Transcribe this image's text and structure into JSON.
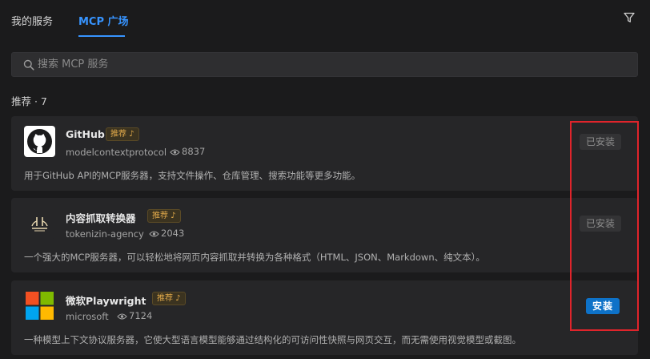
{
  "tabs": [
    {
      "label": "我的服务",
      "active": false
    },
    {
      "label": "MCP 广场",
      "active": true
    }
  ],
  "search": {
    "placeholder": "搜索 MCP 服务"
  },
  "section": {
    "label": "推荐 · 7"
  },
  "cards": [
    {
      "name": "GitHub",
      "badge": "推荐",
      "author": "modelcontextprotocol",
      "views": "8837",
      "description": "用于GitHub API的MCP服务器，支持文件操作、仓库管理、搜索功能等更多功能。",
      "action": "已安装",
      "installed": true,
      "logo": "github-icon"
    },
    {
      "name": "内容抓取转换器",
      "badge": "推荐",
      "author": "tokenizin-agency",
      "views": "2043",
      "description": "一个强大的MCP服务器，可以轻松地将网页内容抓取并转换为各种格式（HTML、JSON、Markdown、纯文本）。",
      "action": "已安装",
      "installed": true,
      "logo": "crawler-icon"
    },
    {
      "name": "微软Playwright",
      "badge": "推荐",
      "author": "microsoft",
      "views": "7124",
      "description": "一种模型上下文协议服务器，它使大型语言模型能够通过结构化的可访问性快照与网页交互，而无需使用视觉模型或截图。",
      "action": "安装",
      "installed": false,
      "logo": "microsoft-icon"
    }
  ],
  "colors": {
    "background": "#1b1b1c",
    "card": "#262628",
    "accent": "#3794ff",
    "install_button": "#0e72c8",
    "badge_text": "#e0a94a",
    "highlight": "#e0242b"
  }
}
